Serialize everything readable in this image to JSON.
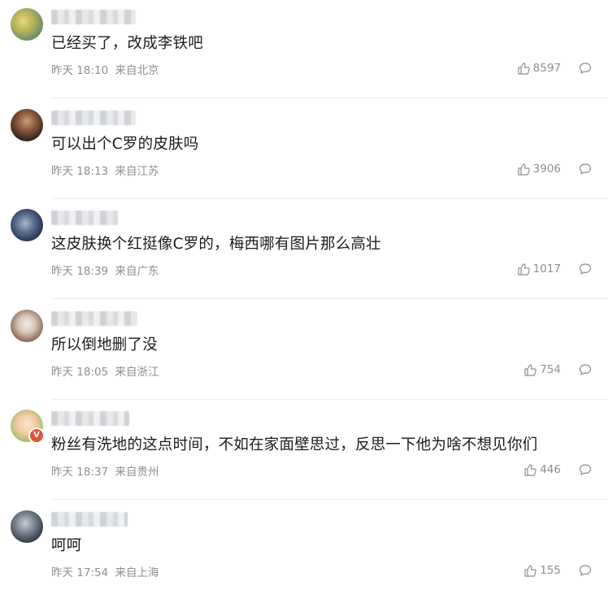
{
  "colors": {
    "text": "#1b1b1b",
    "meta": "#8e8e8e",
    "divider": "#ececec",
    "verified_badge": "#e0533c"
  },
  "comments": [
    {
      "text": "已经买了，改成李铁吧",
      "time": "昨天 18:10",
      "location": "来自北京",
      "likes": "8597"
    },
    {
      "text": "可以出个C罗的皮肤吗",
      "time": "昨天 18:13",
      "location": "来自江苏",
      "likes": "3906"
    },
    {
      "text": "这皮肤换个红挺像C罗的，梅西哪有图片那么高壮",
      "time": "昨天 18:39",
      "location": "来自广东",
      "likes": "1017"
    },
    {
      "text": "所以倒地删了没",
      "time": "昨天 18:05",
      "location": "来自浙江",
      "likes": "754"
    },
    {
      "text": "粉丝有洗地的这点时间，不如在家面壁思过，反思一下他为啥不想见你们",
      "time": "昨天 18:37",
      "location": "来自贵州",
      "likes": "446",
      "verified_badge": "V"
    },
    {
      "text": "呵呵",
      "time": "昨天 17:54",
      "location": "来自上海",
      "likes": "155"
    }
  ]
}
